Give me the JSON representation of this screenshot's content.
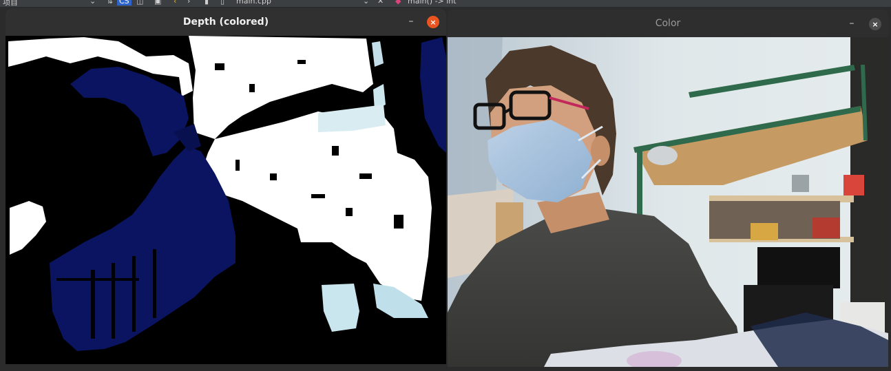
{
  "ide": {
    "project_label": "项目",
    "cs_badge": "CS",
    "file_tab": "main.cpp",
    "function_crumb": "main() -> int"
  },
  "depth_window": {
    "title": "Depth (colored)",
    "close_glyph": "×",
    "minimize_glyph": "–"
  },
  "color_window": {
    "title": "Color",
    "close_glyph": "×",
    "minimize_glyph": "–"
  },
  "colors": {
    "ubuntu_close": "#e95420",
    "depth_near": "#0a1460",
    "depth_mid": "#c9e6ee",
    "depth_far": "#ffffff",
    "titlebar": "#303030"
  }
}
